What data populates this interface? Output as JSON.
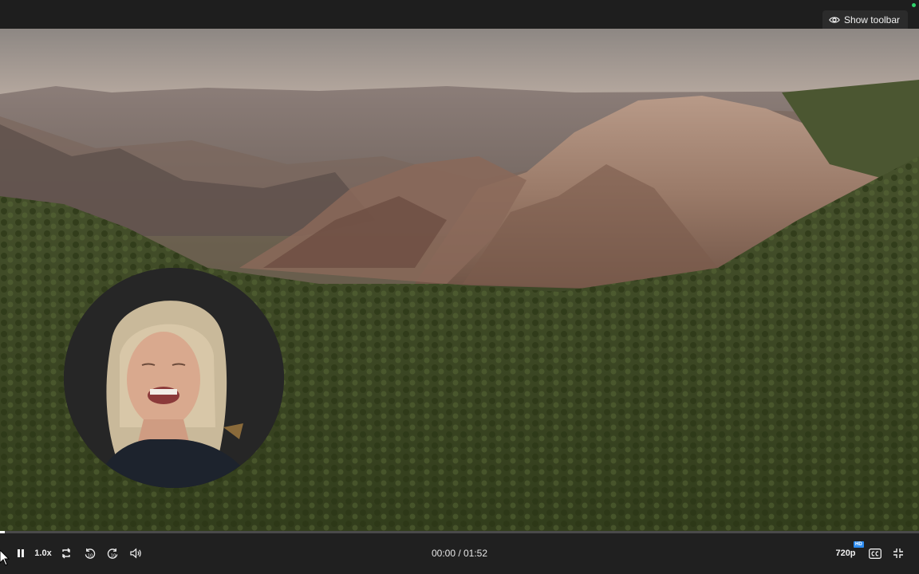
{
  "top_bar": {
    "show_toolbar_label": "Show toolbar"
  },
  "player": {
    "speed": "1.0x",
    "time_display": "00:00 / 01:52",
    "quality": "720p",
    "quality_badge": "HD",
    "progress_fraction": 0.005
  },
  "icons": [
    "eye-icon",
    "pause-icon",
    "loop-icon",
    "rewind-10-icon",
    "forward-10-icon",
    "volume-icon",
    "captions-icon",
    "exit-fullscreen-icon",
    "mouse-cursor-icon"
  ],
  "colors": {
    "accent": "#2d8cf0",
    "status": "#2fd36b",
    "progress": "#ffffff"
  }
}
